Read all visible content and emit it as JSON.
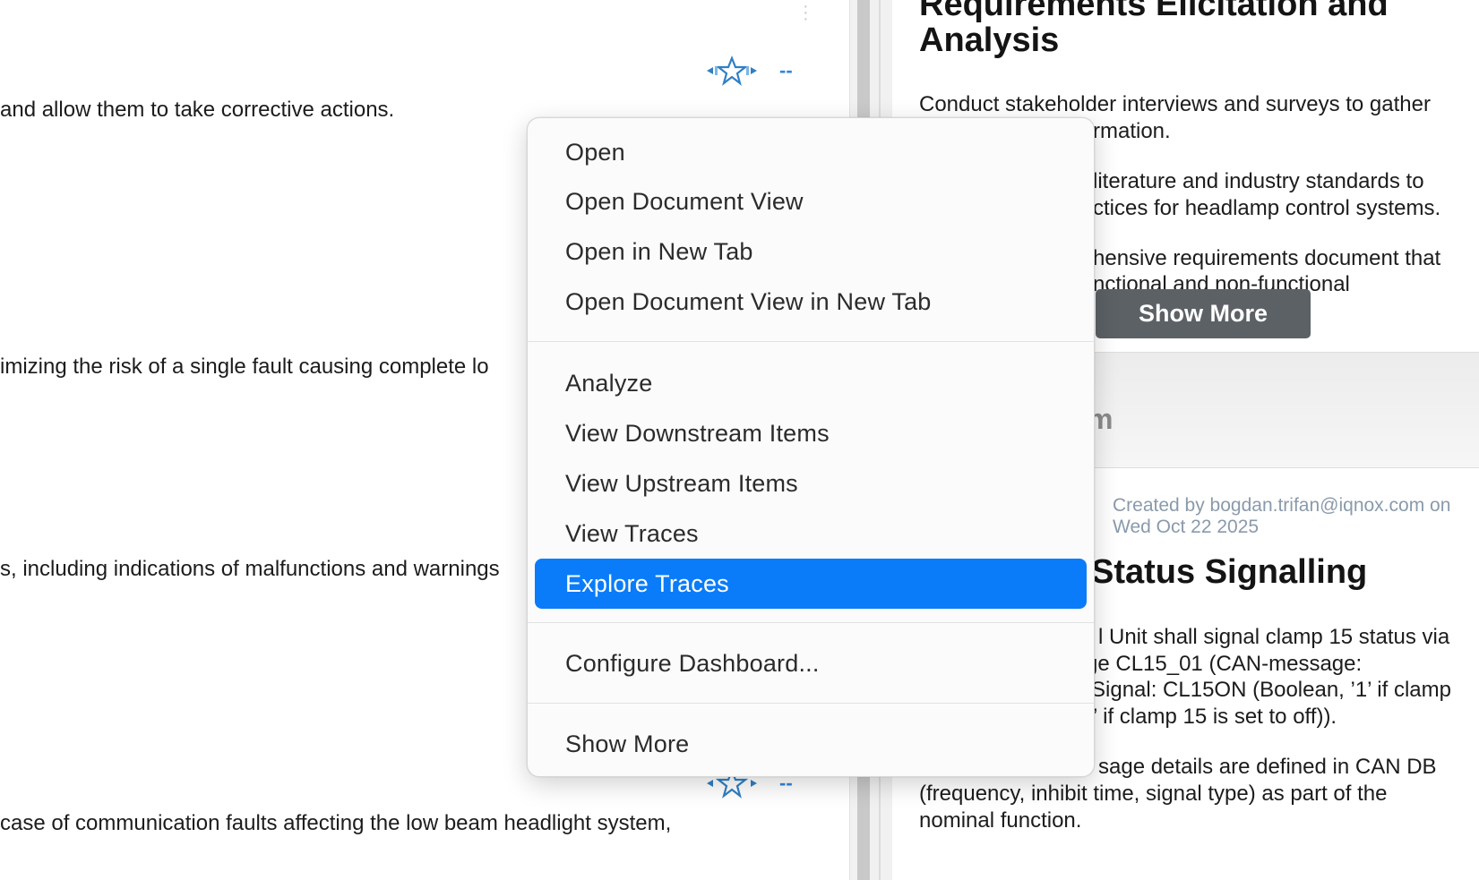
{
  "left_pane": {
    "lines": [
      "and allow them to take corrective actions.",
      "imizing the risk of a single fault causing complete lo",
      "s, including indications of malfunctions and warnings",
      " case of communication faults affecting the low beam headlight system,"
    ],
    "rating_placeholder": "--"
  },
  "right_pane": {
    "card1": {
      "title_line1": "Requirements Elicitation and",
      "title_line2": "Analysis",
      "para1_line1": "Conduct stakeholder interviews and surveys to gather",
      "para1_line2": "rmation.",
      "para2_line1": "literature and industry standards to",
      "para2_line2": "ctices for headlamp control systems.",
      "para3_line1": "hensive requirements document that",
      "para3_line2": "nctional and non-functional",
      "show_more": "Show More"
    },
    "footer_fragment": "m",
    "card2": {
      "meta_line1": "Created by bogdan.trifan@iqnox.com on",
      "meta_line2": "Wed Oct 22 2025",
      "title": "Status Signalling",
      "para1_line1": "l Unit shall signal clamp 15 status via",
      "para1_line2": "ge CL15_01 (CAN-message:",
      "para1_line3": "Signal: CL15ON (Boolean, ’1’ if clamp",
      "para1_line4": "’ if clamp 15 is set to off)).",
      "para2_line1": "sage details are defined in CAN DB",
      "para2_line2": "(frequency, inhibit time, signal type) as part of the",
      "para2_line3": "nominal function."
    }
  },
  "context_menu": {
    "group1": [
      "Open",
      "Open Document View",
      "Open in New Tab",
      "Open Document View in New Tab"
    ],
    "group2": [
      "Analyze",
      "View Downstream Items",
      "View Upstream Items",
      "View Traces",
      "Explore Traces"
    ],
    "group3": [
      "Configure Dashboard..."
    ],
    "group4": [
      "Show More"
    ],
    "highlighted": "Explore Traces"
  },
  "colors": {
    "menu_highlight": "#0a7cf9",
    "show_more_button": "#5c6166",
    "star_accent": "#2f7fc5"
  }
}
